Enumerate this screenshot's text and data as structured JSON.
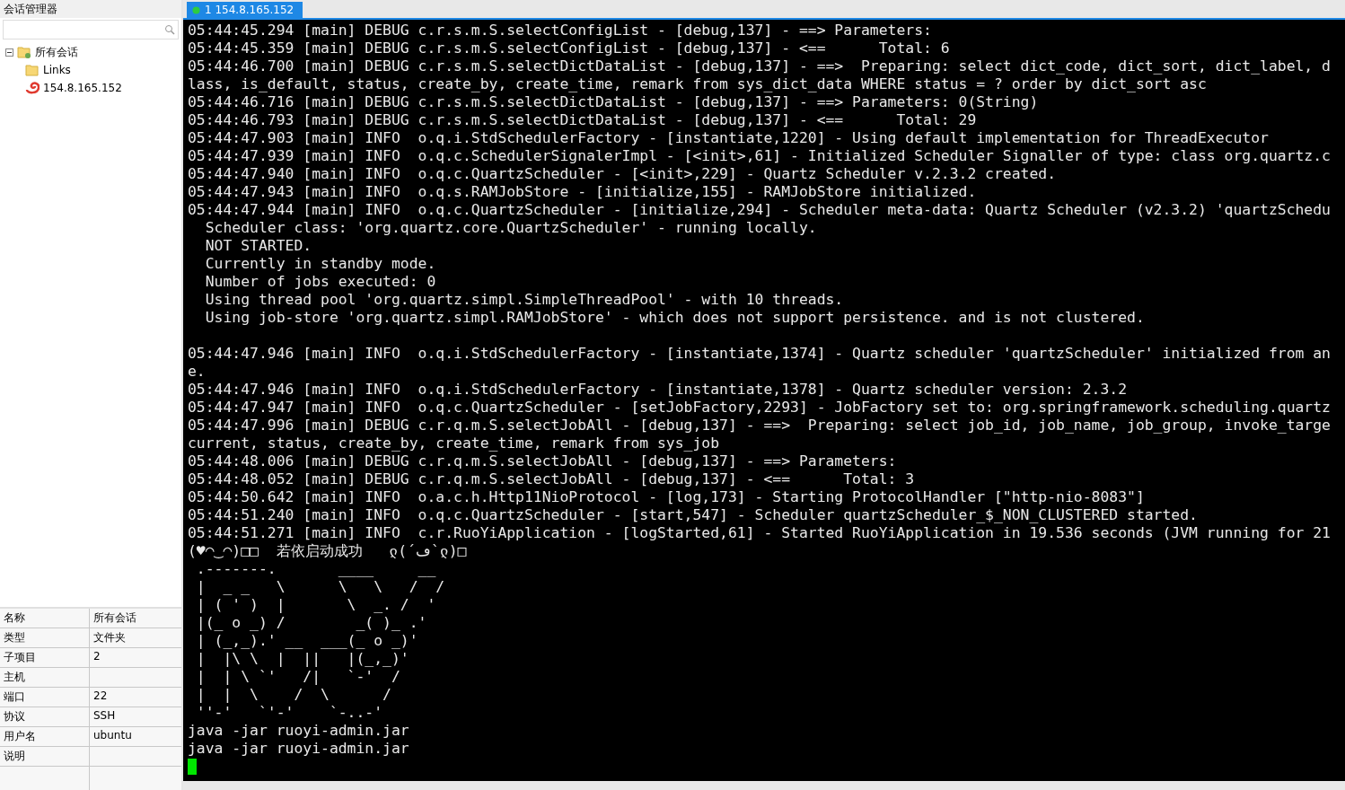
{
  "session_panel": {
    "title": "会话管理器",
    "tree": [
      {
        "label": "所有会话",
        "kind": "group",
        "expanded": true,
        "children": [
          {
            "label": "Links",
            "kind": "folder"
          },
          {
            "label": "154.8.165.152",
            "kind": "session"
          }
        ]
      }
    ],
    "properties": [
      {
        "name": "名称",
        "value": "所有会话"
      },
      {
        "name": "类型",
        "value": "文件夹"
      },
      {
        "name": "子项目",
        "value": "2"
      },
      {
        "name": "主机"
      },
      {
        "name": "端口",
        "value": "22"
      },
      {
        "name": "协议",
        "value": "SSH"
      },
      {
        "name": "用户名",
        "value": "ubuntu"
      },
      {
        "name": "说明"
      }
    ]
  },
  "tabs": [
    {
      "label": "1 154.8.165.152",
      "selected": true,
      "connected": true
    }
  ],
  "terminal": {
    "lines": [
      {
        "text": "05:44:45.294 [main] DEBUG c.r.s.m.S.selectConfigList - [debug,137] - ==> Parameters:"
      },
      {
        "text": "05:44:45.359 [main] DEBUG c.r.s.m.S.selectConfigList - [debug,137] - <==      Total: 6"
      },
      {
        "text": "05:44:46.700 [main] DEBUG c.r.s.m.S.selectDictDataList - [debug,137] - ==>  Preparing: select dict_code, dict_sort, dict_label, d"
      },
      {
        "text": "lass, is_default, status, create_by, create_time, remark from sys_dict_data WHERE status = ? order by dict_sort asc"
      },
      {
        "text": "05:44:46.716 [main] DEBUG c.r.s.m.S.selectDictDataList - [debug,137] - ==> Parameters: 0(String)"
      },
      {
        "text": "05:44:46.793 [main] DEBUG c.r.s.m.S.selectDictDataList - [debug,137] - <==      Total: 29"
      },
      {
        "text": "05:44:47.903 [main] INFO  o.q.i.StdSchedulerFactory - [instantiate,1220] - Using default implementation for ThreadExecutor"
      },
      {
        "text": "05:44:47.939 [main] INFO  o.q.c.SchedulerSignalerImpl - [<init>,61] - Initialized Scheduler Signaller of type: class org.quartz.c"
      },
      {
        "text": "05:44:47.940 [main] INFO  o.q.c.QuartzScheduler - [<init>,229] - Quartz Scheduler v.2.3.2 created."
      },
      {
        "text": "05:44:47.943 [main] INFO  o.q.s.RAMJobStore - [initialize,155] - RAMJobStore initialized."
      },
      {
        "text": "05:44:47.944 [main] INFO  o.q.c.QuartzScheduler - [initialize,294] - Scheduler meta-data: Quartz Scheduler (v2.3.2) 'quartzSchedu"
      },
      {
        "text": "  Scheduler class: 'org.quartz.core.QuartzScheduler' - running locally."
      },
      {
        "text": "  NOT STARTED."
      },
      {
        "text": "  Currently in standby mode."
      },
      {
        "text": "  Number of jobs executed: 0"
      },
      {
        "text": "  Using thread pool 'org.quartz.simpl.SimpleThreadPool' - with 10 threads."
      },
      {
        "text": "  Using job-store 'org.quartz.simpl.RAMJobStore' - which does not support persistence. and is not clustered."
      },
      {
        "kind": "blank"
      },
      {
        "text": "05:44:47.946 [main] INFO  o.q.i.StdSchedulerFactory - [instantiate,1374] - Quartz scheduler 'quartzScheduler' initialized from an"
      },
      {
        "text": "e."
      },
      {
        "text": "05:44:47.946 [main] INFO  o.q.i.StdSchedulerFactory - [instantiate,1378] - Quartz scheduler version: 2.3.2"
      },
      {
        "text": "05:44:47.947 [main] INFO  o.q.c.QuartzScheduler - [setJobFactory,2293] - JobFactory set to: org.springframework.scheduling.quartz"
      },
      {
        "text": "05:44:47.996 [main] DEBUG c.r.q.m.S.selectJobAll - [debug,137] - ==>  Preparing: select job_id, job_name, job_group, invoke_targe"
      },
      {
        "text": "current, status, create_by, create_time, remark from sys_job"
      },
      {
        "text": "05:44:48.006 [main] DEBUG c.r.q.m.S.selectJobAll - [debug,137] - ==> Parameters:"
      },
      {
        "text": "05:44:48.052 [main] DEBUG c.r.q.m.S.selectJobAll - [debug,137] - <==      Total: 3"
      },
      {
        "text": "05:44:50.642 [main] INFO  o.a.c.h.Http11NioProtocol - [log,173] - Starting ProtocolHandler [\"http-nio-8083\"]"
      },
      {
        "text": "05:44:51.240 [main] INFO  o.q.c.QuartzScheduler - [start,547] - Scheduler quartzScheduler_$_NON_CLUSTERED started."
      },
      {
        "text": "05:44:51.271 [main] INFO  c.r.RuoYiApplication - [logStarted,61] - Started RuoYiApplication in 19.536 seconds (JVM running for 21"
      },
      {
        "text": "(♥◠‿◠)□□  若依启动成功   ლ(´ڡ`ლ)□"
      },
      {
        "text": " .-------.       ____     __"
      },
      {
        "text": " |  _ _   \\      \\   \\   /  /"
      },
      {
        "text": " | ( ' )  |       \\  _. /  '"
      },
      {
        "text": " |(_ o _) /        _( )_ .'"
      },
      {
        "text": " | (_,_).' __  ___(_ o _)'"
      },
      {
        "text": " |  |\\ \\  |  ||   |(_,_)'"
      },
      {
        "text": " |  | \\ `'   /|   `-'  /"
      },
      {
        "text": " |  |  \\    /  \\      /"
      },
      {
        "text": " ''-'   `'-'    `-..-'"
      },
      {
        "text": "java -jar ruoyi-admin.jar"
      },
      {
        "text": "java -jar ruoyi-admin.jar"
      },
      {
        "kind": "cursor"
      }
    ]
  }
}
